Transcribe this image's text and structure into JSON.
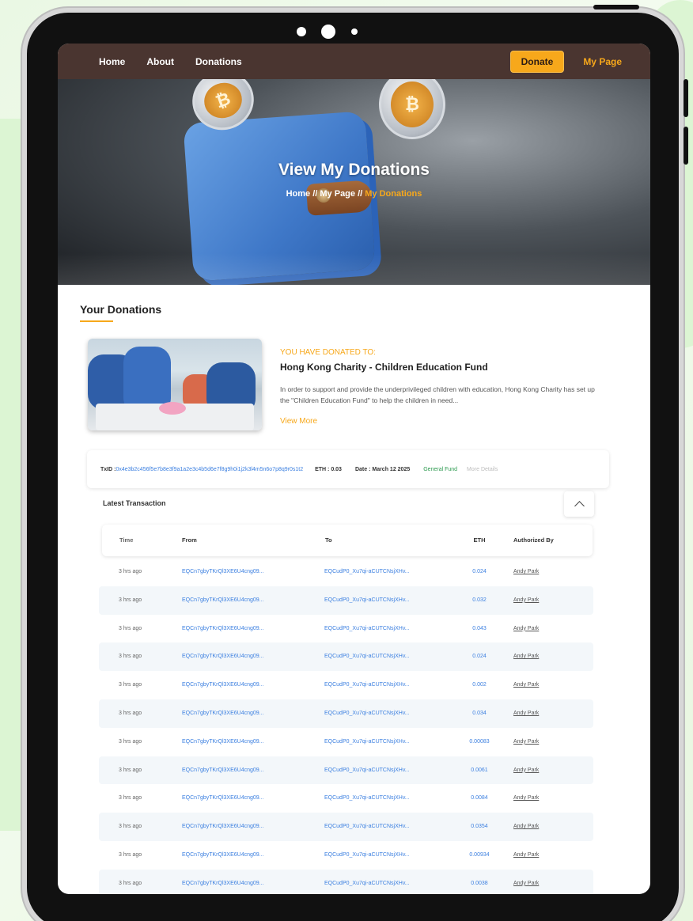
{
  "nav": {
    "links": [
      "Home",
      "About",
      "Donations"
    ],
    "donate_label": "Donate",
    "mypage_label": "My Page"
  },
  "hero": {
    "title": "View My Donations",
    "breadcrumb_home": "Home",
    "breadcrumb_sep1": " // ",
    "breadcrumb_mypage": "My Page",
    "breadcrumb_sep2": " // ",
    "breadcrumb_current": "My Donations"
  },
  "donations": {
    "section_title": "Your Donations",
    "donated_to_label": "YOU HAVE DONATED TO:",
    "charity_name": "Hong Kong Charity - Children Education Fund",
    "description": "In order to support and provide the underprivileged children with education, Hong Kong Charity has set up the \"Children Education Fund\" to help the children in need...",
    "view_more": "View More"
  },
  "transaction": {
    "txid_label": "TxID : ",
    "txid_value": "0x4e3b2c456f5e7b8e3f9a1a2e3c4b5d6e7f8g9h0i1j2k3l4m5n6o7p8q9r0s1t2",
    "eth": "ETH : 0.03",
    "date": "Date : March 12 2025",
    "fund": "General Fund",
    "more_details": "More Details"
  },
  "latest": {
    "title": "Latest Transaction",
    "columns": {
      "time": "Time",
      "from": "From",
      "to": "To",
      "eth": "ETH",
      "auth": "Authorized By"
    },
    "rows": [
      {
        "time": "3 hrs ago",
        "from": "EQCn7gbyTKrQl3XE6U4cng09...",
        "to": "EQCudP0_Xu7qi-aCUTCNsjXHv...",
        "eth": "0.024",
        "auth": "Andy Park"
      },
      {
        "time": "3 hrs ago",
        "from": "EQCn7gbyTKrQl3XE6U4cng09...",
        "to": "EQCudP0_Xu7qi-aCUTCNsjXHv...",
        "eth": "0.032",
        "auth": "Andy Park"
      },
      {
        "time": "3 hrs ago",
        "from": "EQCn7gbyTKrQl3XE6U4cng09...",
        "to": "EQCudP0_Xu7qi-aCUTCNsjXHv...",
        "eth": "0.043",
        "auth": "Andy Park"
      },
      {
        "time": "3 hrs ago",
        "from": "EQCn7gbyTKrQl3XE6U4cng09...",
        "to": "EQCudP0_Xu7qi-aCUTCNsjXHv...",
        "eth": "0.024",
        "auth": "Andy Park"
      },
      {
        "time": "3 hrs ago",
        "from": "EQCn7gbyTKrQl3XE6U4cng09...",
        "to": "EQCudP0_Xu7qi-aCUTCNsjXHv...",
        "eth": "0.002",
        "auth": "Andy Park"
      },
      {
        "time": "3 hrs ago",
        "from": "EQCn7gbyTKrQl3XE6U4cng09...",
        "to": "EQCudP0_Xu7qi-aCUTCNsjXHv...",
        "eth": "0.034",
        "auth": "Andy Park"
      },
      {
        "time": "3 hrs ago",
        "from": "EQCn7gbyTKrQl3XE6U4cng09...",
        "to": "EQCudP0_Xu7qi-aCUTCNsjXHv...",
        "eth": "0.00083",
        "auth": "Andy Park"
      },
      {
        "time": "3 hrs ago",
        "from": "EQCn7gbyTKrQl3XE6U4cng09...",
        "to": "EQCudP0_Xu7qi-aCUTCNsjXHv...",
        "eth": "0.0061",
        "auth": "Andy Park"
      },
      {
        "time": "3 hrs ago",
        "from": "EQCn7gbyTKrQl3XE6U4cng09...",
        "to": "EQCudP0_Xu7qi-aCUTCNsjXHv...",
        "eth": "0.0084",
        "auth": "Andy Park"
      },
      {
        "time": "3 hrs ago",
        "from": "EQCn7gbyTKrQl3XE6U4cng09...",
        "to": "EQCudP0_Xu7qi-aCUTCNsjXHv...",
        "eth": "0.0354",
        "auth": "Andy Park"
      },
      {
        "time": "3 hrs ago",
        "from": "EQCn7gbyTKrQl3XE6U4cng09...",
        "to": "EQCudP0_Xu7qi-aCUTCNsjXHv...",
        "eth": "0.00934",
        "auth": "Andy Park"
      },
      {
        "time": "3 hrs ago",
        "from": "EQCn7gbyTKrQl3XE6U4cng09...",
        "to": "EQCudP0_Xu7qi-aCUTCNsjXHv...",
        "eth": "0.0038",
        "auth": "Andy Park"
      }
    ]
  },
  "colors": {
    "accent": "#f7a81b",
    "nav_bg": "#4a3530",
    "link": "#3b7fe0",
    "fund": "#2c9a4f"
  },
  "icons": {
    "coin_left": "coin-icon",
    "coin_right": "bitcoin-coin-icon",
    "collapse": "chevron-up-icon"
  }
}
